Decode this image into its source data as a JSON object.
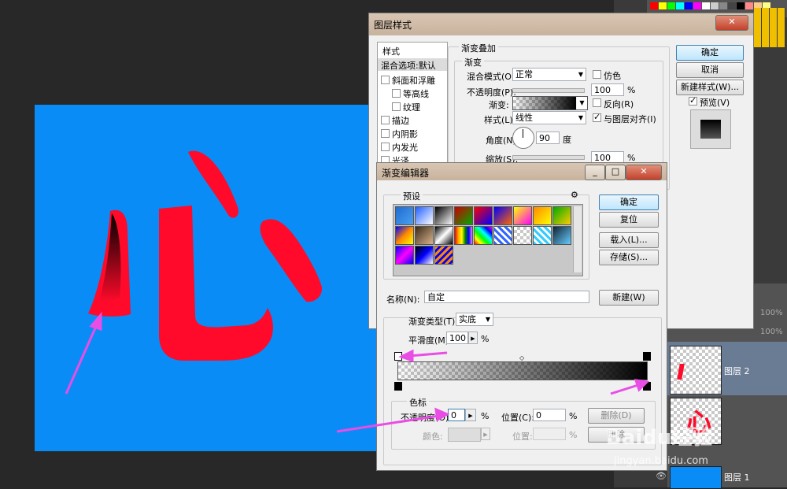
{
  "layer_style": {
    "title": "图层样式",
    "styles_header": "样式",
    "style_items": [
      "混合选项:默认",
      "斜面和浮雕",
      "等高线",
      "纹理",
      "描边",
      "内阴影",
      "内发光",
      "光泽"
    ],
    "section": "渐变叠加",
    "subsection": "渐变",
    "blend_mode_label": "混合模式(O):",
    "blend_mode_value": "正常",
    "dither_label": "仿色",
    "opacity_label": "不透明度(P):",
    "opacity_value": "100",
    "percent": "%",
    "gradient_label": "渐变:",
    "reverse_label": "反向(R)",
    "style_label": "样式(L):",
    "style_value": "线性",
    "align_label": "与图层对齐(I)",
    "angle_label": "角度(N):",
    "angle_value": "90",
    "degree": "度",
    "scale_label": "缩放(S):",
    "scale_value": "100",
    "ok": "确定",
    "cancel": "取消",
    "new_style": "新建样式(W)...",
    "preview": "预览(V)"
  },
  "gradient_editor": {
    "title": "渐变编辑器",
    "presets_label": "预设",
    "ok": "确定",
    "reset": "复位",
    "load": "载入(L)...",
    "save": "存储(S)...",
    "name_label": "名称(N):",
    "name_value": "自定",
    "new_button": "新建(W)",
    "type_label": "渐变类型(T):",
    "type_value": "实底",
    "smooth_label": "平滑度(M):",
    "smooth_value": "100",
    "percent": "%",
    "stops_label": "色标",
    "stop_opacity_label": "不透明度(O):",
    "stop_opacity_value": "0",
    "location_label": "位置(C):",
    "location_value": "0",
    "delete_button": "删除(D)",
    "color_label": "颜色:",
    "location2_label": "位置:",
    "delete2_button": "删除"
  },
  "layers": {
    "zoom1": "100%",
    "zoom2": "100%",
    "layer2": "图层 2",
    "layer1": "图层 1"
  },
  "artwork": {
    "glyph": "心"
  },
  "watermark": {
    "brand": "Baidu经验",
    "url": "jingyan.baidu.com"
  },
  "colors": {
    "canvas_blue": "#0a8cf6",
    "glyph_red": "#ff0a2a",
    "arrow": "#e94de6"
  }
}
